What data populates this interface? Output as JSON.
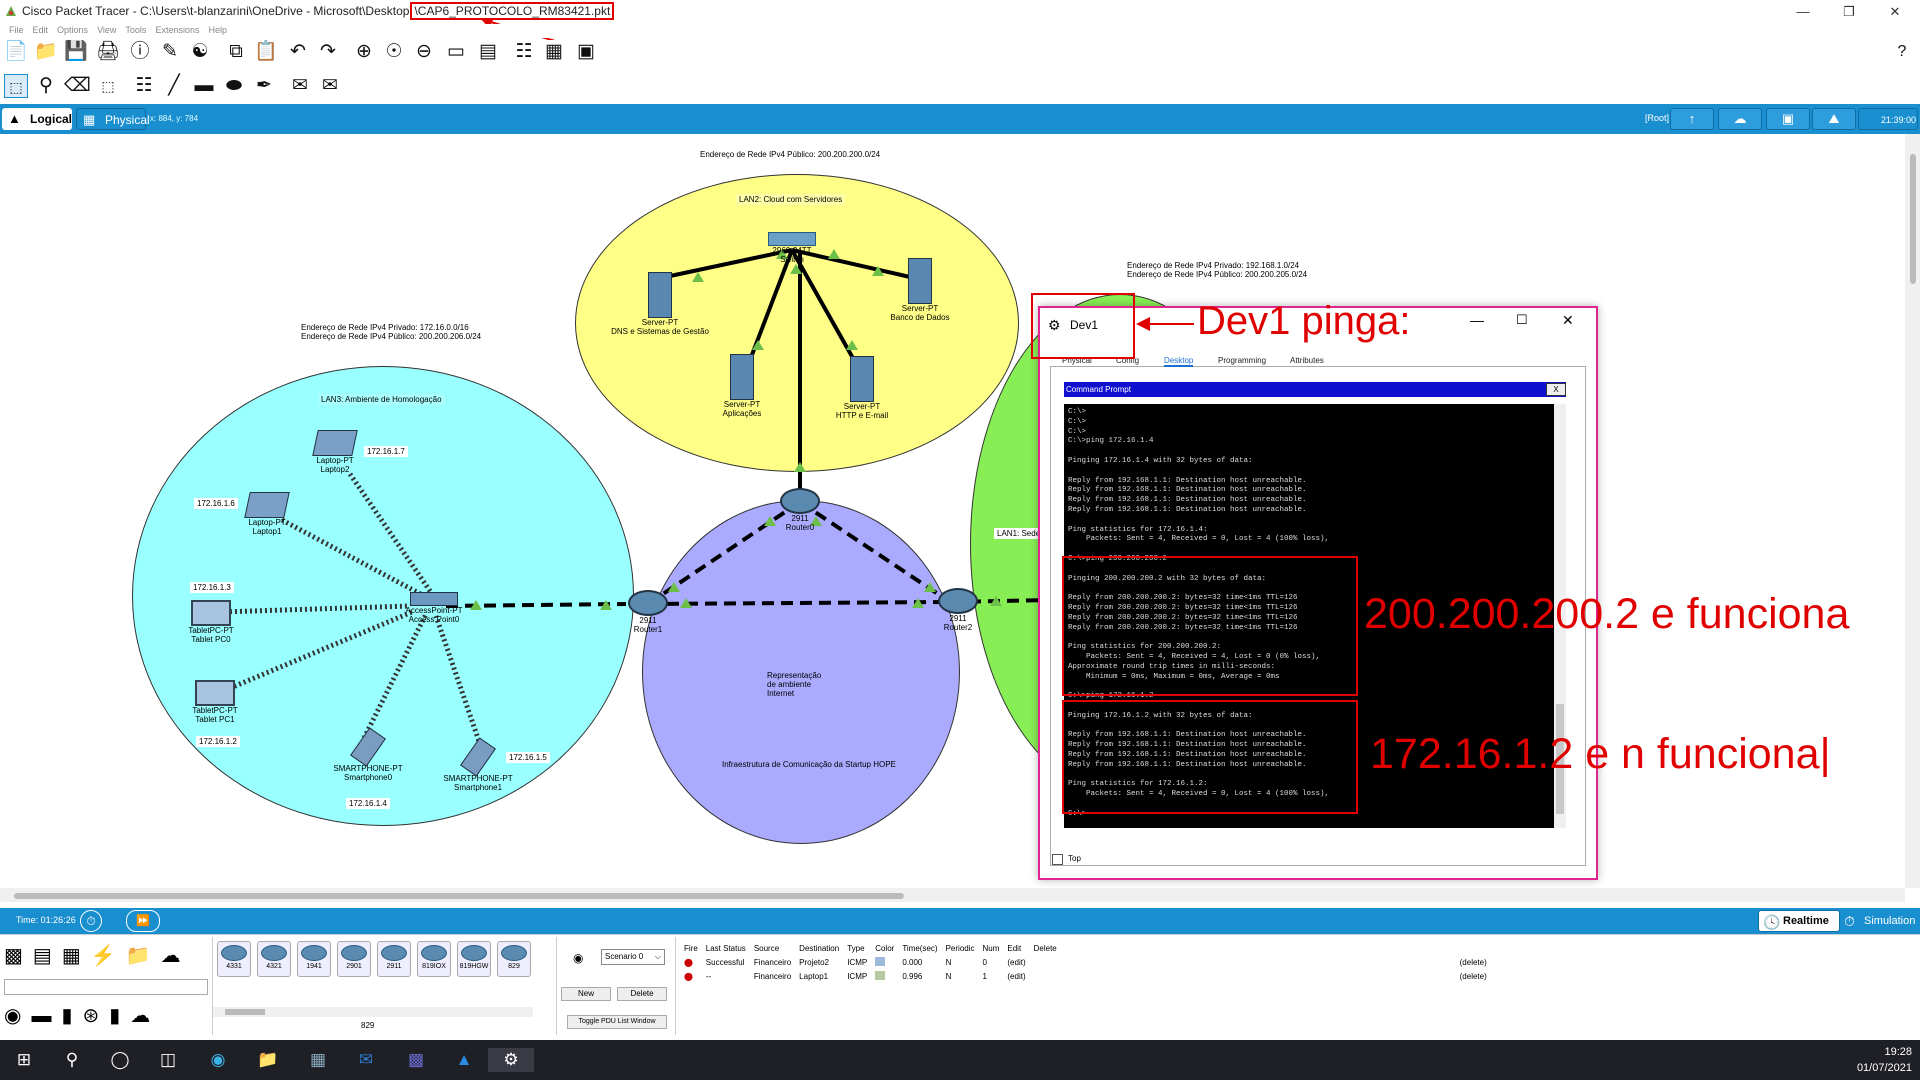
{
  "window": {
    "title_prefix": "Cisco Packet Tracer - C:\\Users\\t-blanzarini\\OneDrive - Microsoft\\Desktop",
    "title_file": "\\CAP6_PROTOCOLO_RM83421.pkt",
    "help": "?"
  },
  "menu": [
    "File",
    "Edit",
    "Options",
    "View",
    "Tools",
    "Extensions",
    "Help"
  ],
  "tabs": {
    "logical": "Logical",
    "physical": "Physical",
    "coords": "x: 884, y: 784"
  },
  "topright": {
    "root": "[Root]",
    "time": "21:39:00"
  },
  "network": {
    "public_net_top": "Endereço de Rede IPv4 Público: 200.200.200.0/24",
    "lan2": "LAN2: Cloud com Servidores",
    "switch": "2960-24TT",
    "switch_name": "Switch",
    "server1": {
      "type": "Server-PT",
      "name": "DNS e Sistemas de Gestão"
    },
    "server2": {
      "type": "Server-PT",
      "name": "Banco de Dados"
    },
    "server3": {
      "type": "Server-PT",
      "name": "Aplicações"
    },
    "server4": {
      "type": "Server-PT",
      "name": "HTTP e E-mail"
    },
    "lan1_net1": "Endereço de Rede IPv4 Privado: 192.168.1.0/24",
    "lan1_net2": "Endereço de Rede IPv4 Público: 200.200.205.0/24",
    "lan1": "LAN1: Sede",
    "lan3_net1": "Endereço de Rede IPv4 Privado: 172.16.0.0/16",
    "lan3_net2": "Endereço de Rede IPv4 Público: 200.200.206.0/24",
    "lan3": "LAN3: Ambiente de Homologação",
    "laptop2": {
      "type": "Laptop-PT",
      "name": "Laptop2",
      "ip": "172.16.1.7"
    },
    "laptop1": {
      "type": "Laptop-PT",
      "name": "Laptop1",
      "ip": "172.16.1.6"
    },
    "tablet0": {
      "type": "TabletPC-PT",
      "name": "Tablet PC0",
      "ip": "172.16.1.3"
    },
    "tablet1": {
      "type": "TabletPC-PT",
      "name": "Tablet PC1",
      "ip": "172.16.1.2"
    },
    "phone0": {
      "type": "SMARTPHONE-PT",
      "name": "Smartphone0",
      "ip": "172.16.1.4"
    },
    "phone1": {
      "type": "SMARTPHONE-PT",
      "name": "Smartphone1",
      "ip": "172.16.1.5"
    },
    "ap": {
      "type": "AccessPoint-PT",
      "name": "Access Point0"
    },
    "router0": {
      "model": "2911",
      "name": "Router0"
    },
    "router1": {
      "model": "2911",
      "name": "Router1"
    },
    "router2": {
      "model": "2911",
      "name": "Router2"
    },
    "internet": "Representação de ambiente Internet",
    "infra": "Infraestrutura de Comunicação da Startup HOPE"
  },
  "dev1": {
    "title": "Dev1",
    "tabs": [
      "Physical",
      "Config",
      "Desktop",
      "Programming",
      "Attributes"
    ],
    "cmd_title": "Command Prompt",
    "cmd_close": "X",
    "terminal": "C:\\>\nC:\\>\nC:\\>\nC:\\>ping 172.16.1.4\n\nPinging 172.16.1.4 with 32 bytes of data:\n\nReply from 192.168.1.1: Destination host unreachable.\nReply from 192.168.1.1: Destination host unreachable.\nReply from 192.168.1.1: Destination host unreachable.\nReply from 192.168.1.1: Destination host unreachable.\n\nPing statistics for 172.16.1.4:\n    Packets: Sent = 4, Received = 0, Lost = 4 (100% loss),\n\nC:\\>ping 200.200.200.2\n\nPinging 200.200.200.2 with 32 bytes of data:\n\nReply from 200.200.200.2: bytes=32 time<1ms TTL=126\nReply from 200.200.200.2: bytes=32 time<1ms TTL=126\nReply from 200.200.200.2: bytes=32 time<1ms TTL=126\nReply from 200.200.200.2: bytes=32 time<1ms TTL=126\n\nPing statistics for 200.200.200.2:\n    Packets: Sent = 4, Received = 4, Lost = 0 (0% loss),\nApproximate round trip times in milli-seconds:\n    Minimum = 0ms, Maximum = 0ms, Average = 0ms\n\nC:\\>ping 172.16.1.2\n\nPinging 172.16.1.2 with 32 bytes of data:\n\nReply from 192.168.1.1: Destination host unreachable.\nReply from 192.168.1.1: Destination host unreachable.\nReply from 192.168.1.1: Destination host unreachable.\nReply from 192.168.1.1: Destination host unreachable.\n\nPing statistics for 172.16.1.2:\n    Packets: Sent = 4, Received = 0, Lost = 4 (100% loss),\n\nC:\\>",
    "top_label": "Top"
  },
  "annotations": {
    "dev1": "Dev1 pinga:",
    "ok": "200.200.200.2 e funciona",
    "fail": "172.16.1.2 e n funciona|"
  },
  "sim": {
    "time": "Time: 01:26:26",
    "realtime": "Realtime",
    "simulation": "Simulation"
  },
  "devices": [
    "4331",
    "4321",
    "1941",
    "2901",
    "2911",
    "819IOX",
    "819HGW",
    "829"
  ],
  "device_selected": "829",
  "scenario": {
    "select": "Scenario 0",
    "new": "New",
    "delete": "Delete",
    "toggle": "Toggle PDU List Window"
  },
  "pdu": {
    "headers": [
      "Fire",
      "Last Status",
      "Source",
      "Destination",
      "Type",
      "Color",
      "Time(sec)",
      "Periodic",
      "Num",
      "Edit",
      "Delete"
    ],
    "rows": [
      {
        "status": "Successful",
        "source": "Financeiro",
        "destination": "Projeto2",
        "type": "ICMP",
        "color": "#9db8d8",
        "time": "0.000",
        "periodic": "N",
        "num": "0",
        "edit": "(edit)",
        "delete": "(delete)"
      },
      {
        "status": "--",
        "source": "Financeiro",
        "destination": "Laptop1",
        "type": "ICMP",
        "color": "#b8c8a0",
        "time": "0.996",
        "periodic": "N",
        "num": "1",
        "edit": "(edit)",
        "delete": "(delete)"
      }
    ]
  },
  "taskbar": {
    "time": "19:28",
    "date": "01/07/2021"
  }
}
